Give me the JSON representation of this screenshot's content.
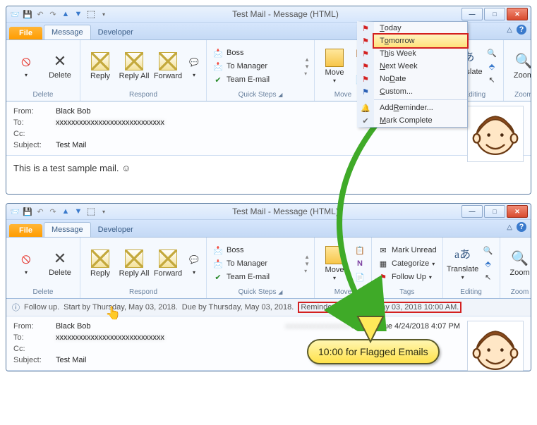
{
  "windowTitle": "Test Mail - Message (HTML)",
  "tabs": {
    "file": "File",
    "message": "Message",
    "developer": "Developer"
  },
  "ribbon": {
    "delete": {
      "x": "",
      "delete": "Delete",
      "group": "Delete"
    },
    "respond": {
      "reply": "Reply",
      "replyAll": "Reply All",
      "forward": "Forward",
      "group": "Respond"
    },
    "quick": {
      "boss": "Boss",
      "toManager": "To Manager",
      "teamEmail": "Team E-mail",
      "group": "Quick Steps"
    },
    "move": {
      "move": "Move",
      "group": "Move"
    },
    "tags": {
      "markUnread": "Mark Unread",
      "categorize": "Categorize",
      "followUp": "Follow Up",
      "group": "Tags"
    },
    "editing": {
      "translate": "Translate",
      "group": "Editing"
    },
    "zoom": {
      "zoom": "Zoom",
      "group": "Zoom"
    }
  },
  "followUpMenu": {
    "today": "Today",
    "tomorrow": "Tomorrow",
    "thisWeek": "This Week",
    "nextWeek": "Next Week",
    "noDate": "No Date",
    "custom": "Custom...",
    "addReminder": "Add Reminder...",
    "markComplete": "Mark Complete"
  },
  "header": {
    "fromLabel": "From:",
    "from": "Black Bob",
    "toLabel": "To:",
    "to": "",
    "ccLabel": "Cc:",
    "cc": "",
    "subjectLabel": "Subject:",
    "subject": "Test Mail",
    "sentLabel": "Sent:",
    "sent": "Tue 4/24/2018 4:07 PM"
  },
  "body": "This is a test sample mail. ☺",
  "infobar": {
    "flag": "Follow up.",
    "start": "Start by Thursday, May 03, 2018.",
    "due": "Due by Thursday, May 03, 2018.",
    "reminder": "Reminder: Thursday, May 03, 2018 10:00 AM."
  },
  "callout": "10:00 for Flagged Emails"
}
